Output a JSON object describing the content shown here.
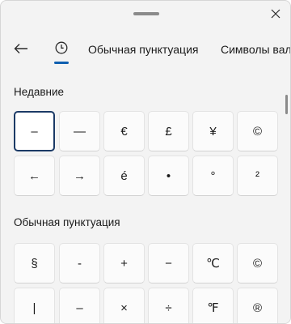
{
  "header": {
    "tabs": {
      "punctuation": "Обычная пунктуация",
      "currency": "Символы вал"
    }
  },
  "recent": {
    "title": "Недавние",
    "symbols": [
      "–",
      "—",
      "€",
      "£",
      "¥",
      "©",
      "←",
      "→",
      "é",
      "•",
      "°",
      "²"
    ]
  },
  "punctuation": {
    "title": "Обычная пунктуация",
    "symbols": [
      "§",
      "-",
      "+",
      "−",
      "℃",
      "©",
      "|",
      "–",
      "×",
      "÷",
      "℉",
      "®"
    ]
  },
  "colors": {
    "panel_bg": "#f3f3f3",
    "key_bg": "#fbfbfb",
    "accent": "#0f5fb0",
    "selected_border": "#1b3a66"
  },
  "icons": {
    "close": "close-icon",
    "back": "back-arrow-icon",
    "recent_tab": "clock-icon"
  }
}
